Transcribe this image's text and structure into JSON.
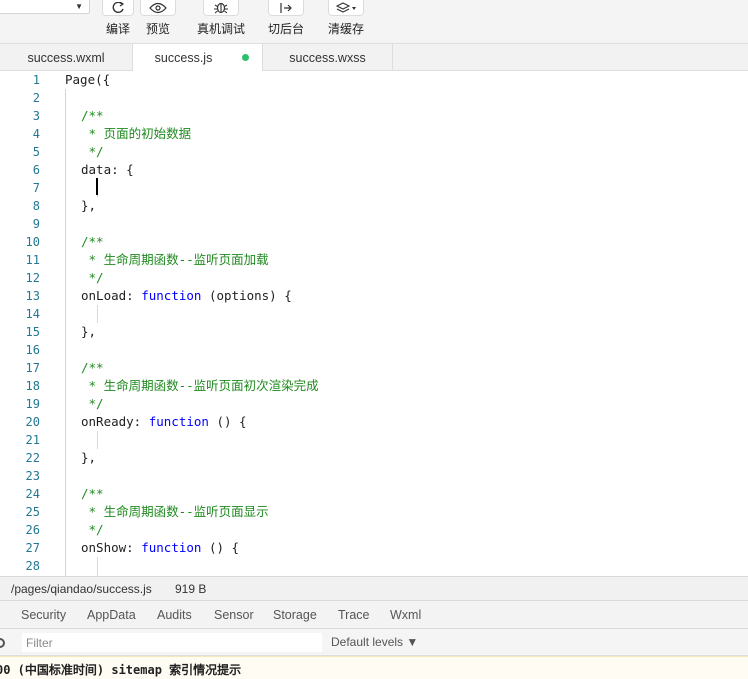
{
  "toolbar": {
    "buttons": [
      {
        "label": "编译",
        "icon": "refresh-icon"
      },
      {
        "label": "预览",
        "icon": "eye-icon"
      },
      {
        "label": "真机调试",
        "icon": "bug-icon"
      },
      {
        "label": "切后台",
        "icon": "switch-background-icon"
      },
      {
        "label": "清缓存",
        "icon": "layers-icon"
      }
    ]
  },
  "tabs": [
    {
      "label": "success.wxml",
      "active": false
    },
    {
      "label": "success.js",
      "active": true,
      "modified": true
    },
    {
      "label": "success.wxss",
      "active": false
    }
  ],
  "editor": {
    "lines": [
      {
        "n": "1",
        "indent": 0,
        "tokens": [
          {
            "t": "Page({",
            "c": "fn"
          }
        ]
      },
      {
        "n": "2",
        "indent": 0,
        "tokens": []
      },
      {
        "n": "3",
        "indent": 1,
        "tokens": [
          {
            "t": "/**",
            "c": "cmt"
          }
        ]
      },
      {
        "n": "4",
        "indent": 1,
        "tokens": [
          {
            "t": " * 页面的初始数据",
            "c": "cmt"
          }
        ]
      },
      {
        "n": "5",
        "indent": 1,
        "tokens": [
          {
            "t": " */",
            "c": "cmt"
          }
        ]
      },
      {
        "n": "6",
        "indent": 1,
        "tokens": [
          {
            "t": "data: {",
            "c": "id"
          }
        ]
      },
      {
        "n": "7",
        "indent": 1,
        "tokens": []
      },
      {
        "n": "8",
        "indent": 1,
        "tokens": [
          {
            "t": "},",
            "c": "id"
          }
        ]
      },
      {
        "n": "9",
        "indent": 0,
        "tokens": []
      },
      {
        "n": "10",
        "indent": 1,
        "tokens": [
          {
            "t": "/**",
            "c": "cmt"
          }
        ]
      },
      {
        "n": "11",
        "indent": 1,
        "tokens": [
          {
            "t": " * 生命周期函数--监听页面加载",
            "c": "cmt"
          }
        ]
      },
      {
        "n": "12",
        "indent": 1,
        "tokens": [
          {
            "t": " */",
            "c": "cmt"
          }
        ]
      },
      {
        "n": "13",
        "indent": 1,
        "tokens": [
          {
            "t": "onLoad: ",
            "c": "id"
          },
          {
            "t": "function",
            "c": "kw"
          },
          {
            "t": " (options) {",
            "c": "id"
          }
        ]
      },
      {
        "n": "14",
        "indent": 1,
        "tokens": []
      },
      {
        "n": "15",
        "indent": 1,
        "tokens": [
          {
            "t": "},",
            "c": "id"
          }
        ]
      },
      {
        "n": "16",
        "indent": 0,
        "tokens": []
      },
      {
        "n": "17",
        "indent": 1,
        "tokens": [
          {
            "t": "/**",
            "c": "cmt"
          }
        ]
      },
      {
        "n": "18",
        "indent": 1,
        "tokens": [
          {
            "t": " * 生命周期函数--监听页面初次渲染完成",
            "c": "cmt"
          }
        ]
      },
      {
        "n": "19",
        "indent": 1,
        "tokens": [
          {
            "t": " */",
            "c": "cmt"
          }
        ]
      },
      {
        "n": "20",
        "indent": 1,
        "tokens": [
          {
            "t": "onReady: ",
            "c": "id"
          },
          {
            "t": "function",
            "c": "kw"
          },
          {
            "t": " () {",
            "c": "id"
          }
        ]
      },
      {
        "n": "21",
        "indent": 1,
        "tokens": []
      },
      {
        "n": "22",
        "indent": 1,
        "tokens": [
          {
            "t": "},",
            "c": "id"
          }
        ]
      },
      {
        "n": "23",
        "indent": 0,
        "tokens": []
      },
      {
        "n": "24",
        "indent": 1,
        "tokens": [
          {
            "t": "/**",
            "c": "cmt"
          }
        ]
      },
      {
        "n": "25",
        "indent": 1,
        "tokens": [
          {
            "t": " * 生命周期函数--监听页面显示",
            "c": "cmt"
          }
        ]
      },
      {
        "n": "26",
        "indent": 1,
        "tokens": [
          {
            "t": " */",
            "c": "cmt"
          }
        ]
      },
      {
        "n": "27",
        "indent": 1,
        "tokens": [
          {
            "t": "onShow: ",
            "c": "id"
          },
          {
            "t": "function",
            "c": "kw"
          },
          {
            "t": " () {",
            "c": "id"
          }
        ]
      },
      {
        "n": "28",
        "indent": 1,
        "tokens": []
      }
    ]
  },
  "statusbar": {
    "path": "/pages/qiandao/success.js",
    "size": "919 B"
  },
  "devtools": {
    "tabs": [
      "Security",
      "AppData",
      "Audits",
      "Sensor",
      "Storage",
      "Trace",
      "Wxml"
    ],
    "filter_placeholder": "Filter",
    "levels_label": "Default levels ▼"
  },
  "console": {
    "message": "00 (中国标准时间) sitemap 索引情况提示"
  },
  "colors": {
    "comment": "#1f8a1f",
    "keyword": "#0000ff",
    "line_number": "#237893",
    "modified_dot": "#2bc16b"
  }
}
